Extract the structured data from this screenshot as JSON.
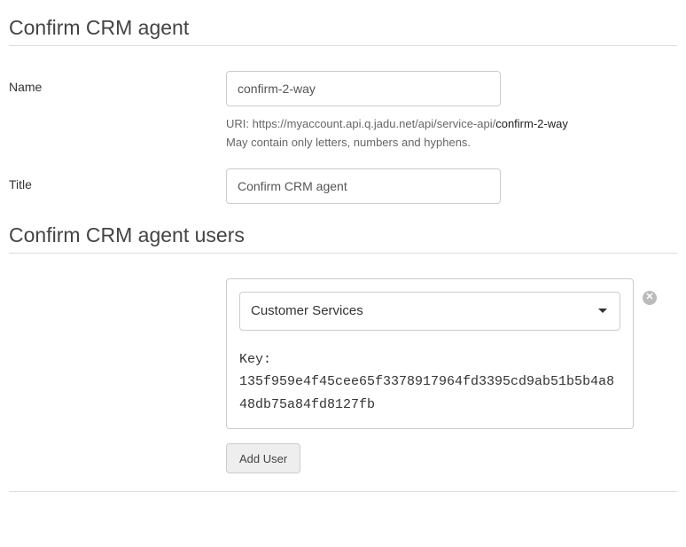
{
  "section1": {
    "heading": "Confirm CRM agent",
    "name": {
      "label": "Name",
      "value": "confirm-2-way",
      "uri_prefix_label": "URI: ",
      "uri_base": "https://myaccount.api.q.jadu.net/api/service-api/",
      "uri_path": "confirm-2-way",
      "hint": "May contain only letters, numbers and hyphens."
    },
    "title": {
      "label": "Title",
      "value": "Confirm CRM agent"
    }
  },
  "section2": {
    "heading": "Confirm CRM agent users",
    "user": {
      "selected": "Customer Services",
      "key_label": "Key:",
      "key_value": "135f959e4f45cee65f3378917964fd3395cd9ab51b5b4a848db75a84fd8127fb"
    },
    "add_user_label": "Add User"
  }
}
